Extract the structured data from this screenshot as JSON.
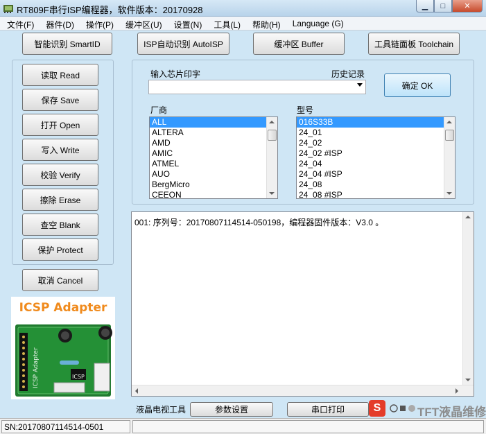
{
  "window": {
    "title": "RT809F串行ISP编程器，软件版本：20170928",
    "minimize_glyph": "▁",
    "maximize_glyph": "□",
    "close_glyph": "✕"
  },
  "menu": [
    "文件(F)",
    "器件(D)",
    "操作(P)",
    "缓冲区(U)",
    "设置(N)",
    "工具(L)",
    "帮助(H)",
    "Language (G)"
  ],
  "toolbar": {
    "smart_id": "智能识别 SmartID",
    "isp_auto": "ISP自动识别 AutoISP",
    "buffer": "缓冲区 Buffer",
    "toolchain": "工具链面板 Toolchain"
  },
  "operations": {
    "read": "读取 Read",
    "save": "保存 Save",
    "open": "打开 Open",
    "write": "写入 Write",
    "verify": "校验 Verify",
    "erase": "擦除 Erase",
    "blank": "查空 Blank",
    "protect": "保护 Protect",
    "cancel": "取消 Cancel"
  },
  "chip": {
    "input_label": "输入芯片印字",
    "history_label": "历史记录",
    "input_value": "",
    "ok_button": "确定 OK"
  },
  "vendor": {
    "label": "厂商",
    "items": [
      "ALL",
      "ALTERA",
      "AMD",
      "AMIC",
      "ATMEL",
      "AUO",
      "BergMicro",
      "CEEON"
    ],
    "selected": 0
  },
  "model": {
    "label": "型号",
    "items": [
      "016S33B",
      "24_01",
      "24_02",
      "24_02 #ISP",
      "24_04",
      "24_04 #ISP",
      "24_08",
      "24_08 #ISP"
    ],
    "selected": 0
  },
  "log": {
    "line1": "001: 序列号：20170807114514-050198，编程器固件版本：V3.0 。"
  },
  "adapter_image": {
    "title": "ICSP Adapter",
    "silk_text": "ICSP Adapter",
    "chip_text": "ICSP"
  },
  "bottom_tools": {
    "lcd_label": "液晶电视工具",
    "params": "参数设置",
    "serial_print": "串口打印"
  },
  "status": {
    "sn": "SN:20170807114514-0501"
  },
  "watermark": {
    "s_glyph": "S",
    "text": "TFT液晶维修网"
  },
  "colors": {
    "window_bg": "#cfe6f5",
    "selection": "#3399ff",
    "adapter_title": "#f08a1c"
  }
}
